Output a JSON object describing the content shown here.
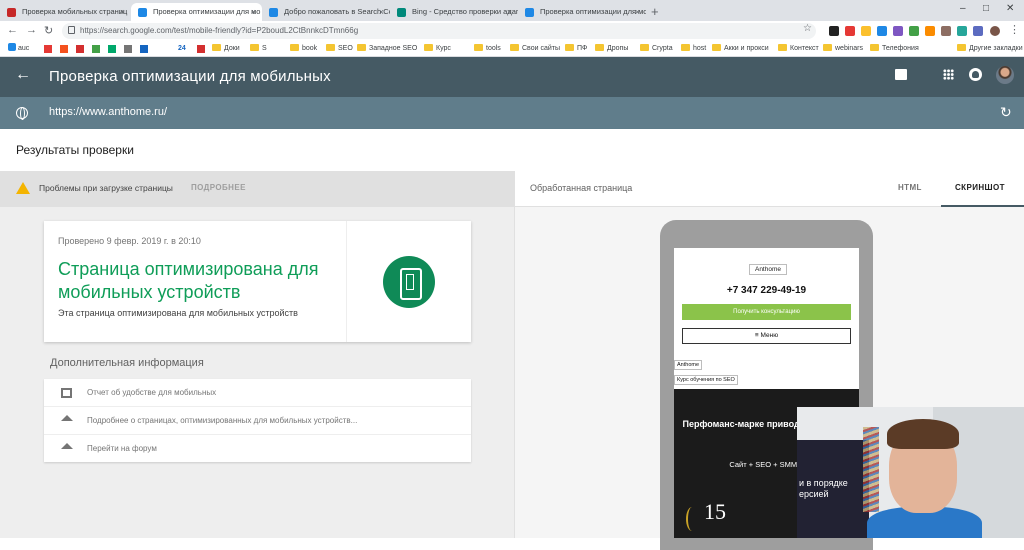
{
  "browser": {
    "tabs": [
      {
        "title": "Проверка мобильных страниц",
        "favicon_color": "#c62828",
        "active": false
      },
      {
        "title": "Проверка оптимизации для мо",
        "favicon_color": "#1e88e5",
        "active": true
      },
      {
        "title": "Добро пожаловать в Search Co",
        "favicon_color": "#1e88e5",
        "active": false
      },
      {
        "title": "Bing - Средство проверки адап",
        "favicon_color": "#00897b",
        "active": false
      },
      {
        "title": "Проверка оптимизации для мо",
        "favicon_color": "#1e88e5",
        "active": false
      }
    ],
    "new_tab_label": "+",
    "address": "https://search.google.com/test/mobile-friendly?id=P2boudL2CtBnnkcDTmn66g",
    "bookmarks": [
      {
        "label": "auc",
        "type": "site"
      },
      {
        "label": "24",
        "type": "site"
      },
      {
        "label": "Доки",
        "type": "folder"
      },
      {
        "label": "S",
        "type": "folder"
      },
      {
        "label": "book",
        "type": "folder"
      },
      {
        "label": "SEO",
        "type": "folder"
      },
      {
        "label": "Западное SEO",
        "type": "folder"
      },
      {
        "label": "Курс",
        "type": "folder"
      },
      {
        "label": "tools",
        "type": "folder"
      },
      {
        "label": "Свои сайты",
        "type": "folder"
      },
      {
        "label": "ПФ",
        "type": "folder"
      },
      {
        "label": "Дропы",
        "type": "folder"
      },
      {
        "label": "Crypta",
        "type": "folder"
      },
      {
        "label": "host",
        "type": "folder"
      },
      {
        "label": "Акки и прокси",
        "type": "folder"
      },
      {
        "label": "Контекст",
        "type": "folder"
      },
      {
        "label": "webinars",
        "type": "folder"
      },
      {
        "label": "Телефония",
        "type": "folder"
      },
      {
        "label": "Другие закладки",
        "type": "folder"
      }
    ]
  },
  "app": {
    "title": "Проверка оптимизации для мобильных",
    "tested_url": "https://www.anthome.ru/",
    "results_title": "Результаты проверки",
    "issues_text": "Проблемы при загрузке страницы",
    "issues_more": "ПОДРОБНЕЕ",
    "card": {
      "date": "Проверено 9 февр. 2019 г. в 20:10",
      "verdict": "Страница оптимизирована для мобильных устройств",
      "subtitle": "Эта страница оптимизирована для мобильных устройств"
    },
    "additional_title": "Дополнительная информация",
    "additional_items": [
      {
        "label": "Отчет об удобстве для мобильных",
        "icon": "report-icon"
      },
      {
        "label": "Подробнее о страницах, оптимизированных для мобильных устройств...",
        "icon": "school-icon"
      },
      {
        "label": "Перейти на форум",
        "icon": "school-icon"
      }
    ],
    "right_panel": {
      "label": "Обработанная страница",
      "tab_html": "HTML",
      "tab_screenshot": "СКРИНШОТ",
      "active_tab": "СКРИНШОТ"
    },
    "preview": {
      "logo": "Anthome",
      "phone": "+7 347 229-49-19",
      "cta": "Получить консультацию",
      "menu": "Меню",
      "link1": "Anthome",
      "link2": "Курс обучения по SEO",
      "headline": "Перфоманс-марке приводим клиенто",
      "services": "Сайт + SEO + SMM +",
      "number": "15"
    },
    "webcam_text": "и в порядке\nерсией"
  },
  "colors": {
    "appbar": "#455a64",
    "urlbar": "#607d8b",
    "success": "#0f9d58",
    "warning": "#f4b400",
    "cta_green": "#8bc34a"
  }
}
